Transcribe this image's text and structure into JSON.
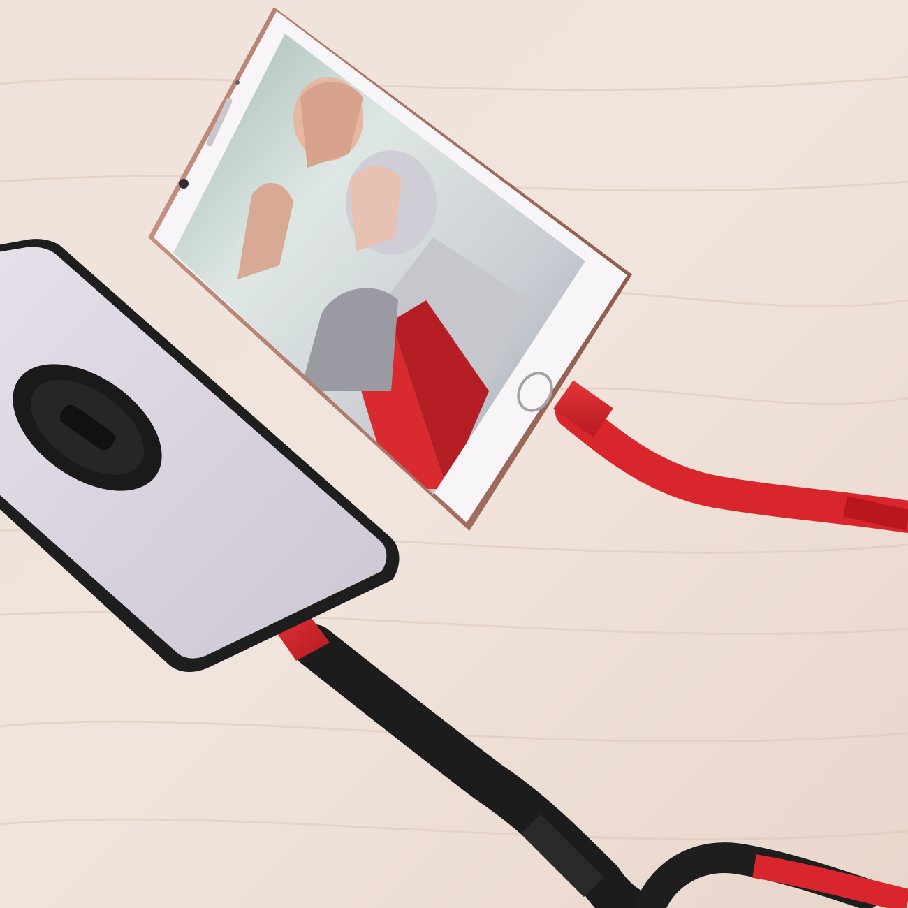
{
  "scene": {
    "description_free": true,
    "subjects": [
      {
        "name": "upright-phone",
        "body_color": "#b98572",
        "front_color": "#f7f5f8"
      },
      {
        "name": "flat-phone",
        "back_color": "#d9d3de",
        "case_color": "#1e1e1e"
      },
      {
        "name": "red-cable",
        "color": "#d8262c"
      },
      {
        "name": "black-cable",
        "color": "#1c1c1c"
      }
    ],
    "ring_holder_text": "",
    "colors": {
      "table": "#ecdcd3",
      "wood_grain": "#d9c3b8",
      "accent_red": "#d8262c",
      "screen_red_carpet": "#d92a2f"
    }
  }
}
